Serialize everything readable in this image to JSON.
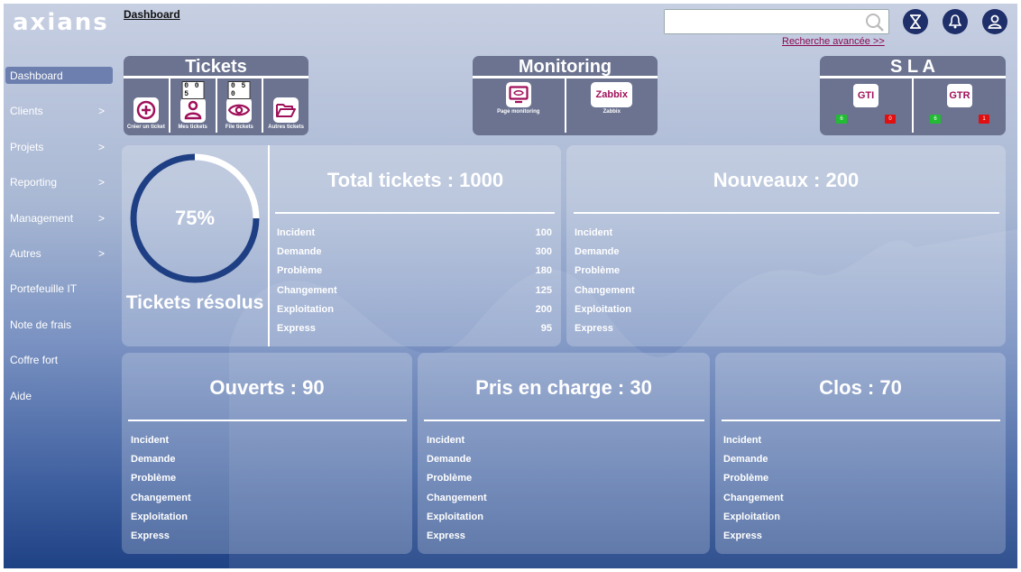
{
  "brand": {
    "logo_text": "axians"
  },
  "breadcrumb": "Dashboard",
  "search": {
    "value": "",
    "placeholder": "",
    "advanced_link": "Recherche avancée >>"
  },
  "header_icons": [
    "hourglass-icon",
    "bell-icon",
    "user-icon"
  ],
  "sidebar": {
    "items": [
      {
        "label": "Dashboard",
        "active": true,
        "has_submenu": false
      },
      {
        "label": "Clients",
        "has_submenu": true
      },
      {
        "label": "Projets",
        "has_submenu": true
      },
      {
        "label": "Reporting",
        "has_submenu": true
      },
      {
        "label": "Management",
        "has_submenu": true
      },
      {
        "label": "Autres",
        "has_submenu": true
      },
      {
        "label": "Portefeuille IT",
        "has_submenu": false
      },
      {
        "label": "Note de frais",
        "has_submenu": false
      },
      {
        "label": "Coffre fort",
        "has_submenu": false
      },
      {
        "label": "Aide",
        "has_submenu": false
      }
    ],
    "chevron": ">"
  },
  "tickets_widget": {
    "title": "Tickets",
    "actions": [
      {
        "label": "Créer un ticket",
        "icon": "plus-circle-icon"
      },
      {
        "label": "Mes tickets",
        "icon": "user-icon",
        "counter": "0 0 5"
      },
      {
        "label": "File tickets",
        "icon": "eye-icon",
        "counter": "0 5 0"
      },
      {
        "label": "Autres tickets",
        "icon": "folder-open-icon"
      }
    ]
  },
  "monitoring_widget": {
    "title": "Monitoring",
    "actions": [
      {
        "label": "Page monitoring",
        "icon": "monitor-eye-icon"
      },
      {
        "label": "Zabbix",
        "button_text": "Zabbix"
      }
    ]
  },
  "sla_widget": {
    "title": "S L A",
    "items": [
      {
        "label": "GTI",
        "green": "6",
        "red": "0"
      },
      {
        "label": "GTR",
        "green": "6",
        "red": "1"
      }
    ]
  },
  "resolved": {
    "percent_label": "75%",
    "percent": 0.75,
    "caption": "Tickets résolus"
  },
  "categories": [
    "Incident",
    "Demande",
    "Problème",
    "Changement",
    "Exploitation",
    "Express"
  ],
  "total": {
    "title": "Total tickets : 1000",
    "values": [
      "100",
      "300",
      "180",
      "125",
      "200",
      "95"
    ]
  },
  "nouveaux": {
    "title": "Nouveaux : 200"
  },
  "ouverts": {
    "title": "Ouverts : 90"
  },
  "pris": {
    "title": "Pris en charge : 30"
  },
  "clos": {
    "title": "Clos : 70"
  },
  "colors": {
    "accent": "#a0105a",
    "dark_blue": "#1f3f84",
    "widget": "#6b7390",
    "green": "#22bb33",
    "red": "#e01010"
  }
}
